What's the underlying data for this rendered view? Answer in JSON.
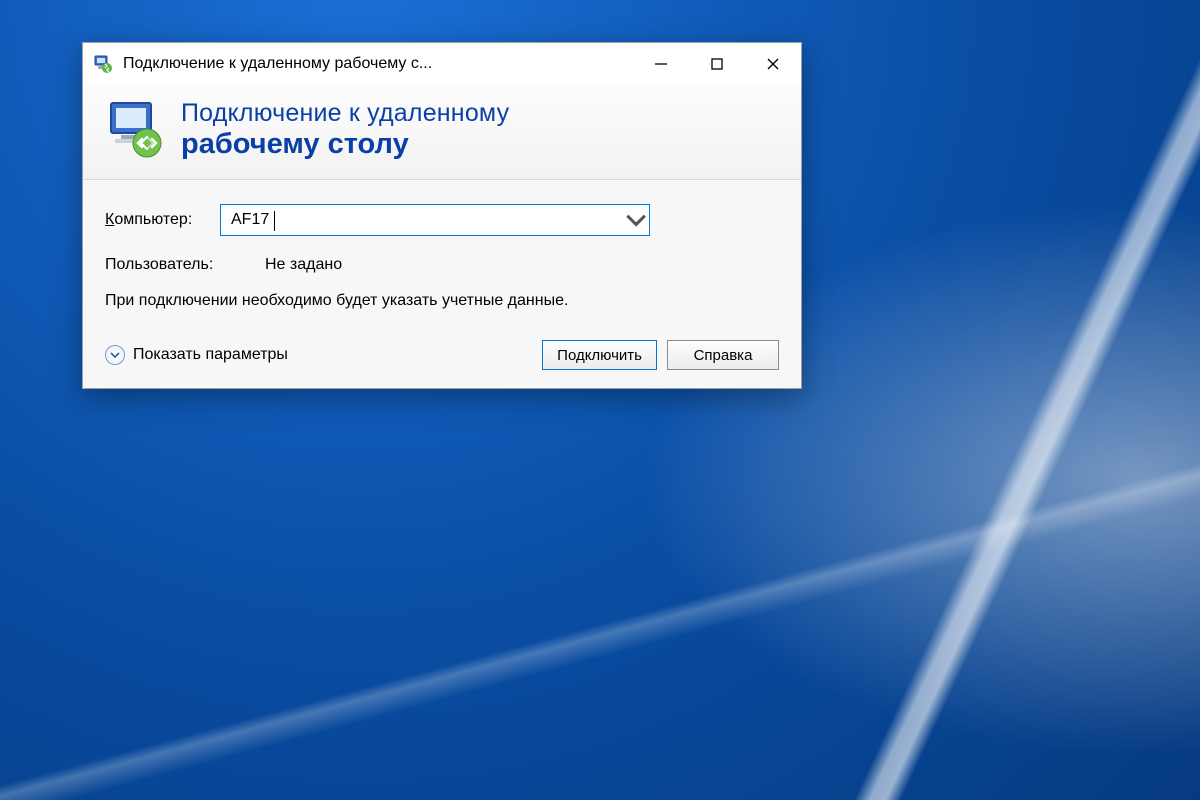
{
  "titlebar": {
    "title": "Подключение к удаленному рабочему с..."
  },
  "banner": {
    "line1": "Подключение к удаленному",
    "line2": "рабочему столу"
  },
  "form": {
    "computer_label": "Компьютер:",
    "computer_value": "AF17",
    "user_label": "Пользователь:",
    "user_value": "Не задано",
    "info": "При подключении необходимо будет указать учетные данные."
  },
  "footer": {
    "show_options": "Показать параметры",
    "connect": "Подключить",
    "help": "Справка"
  }
}
